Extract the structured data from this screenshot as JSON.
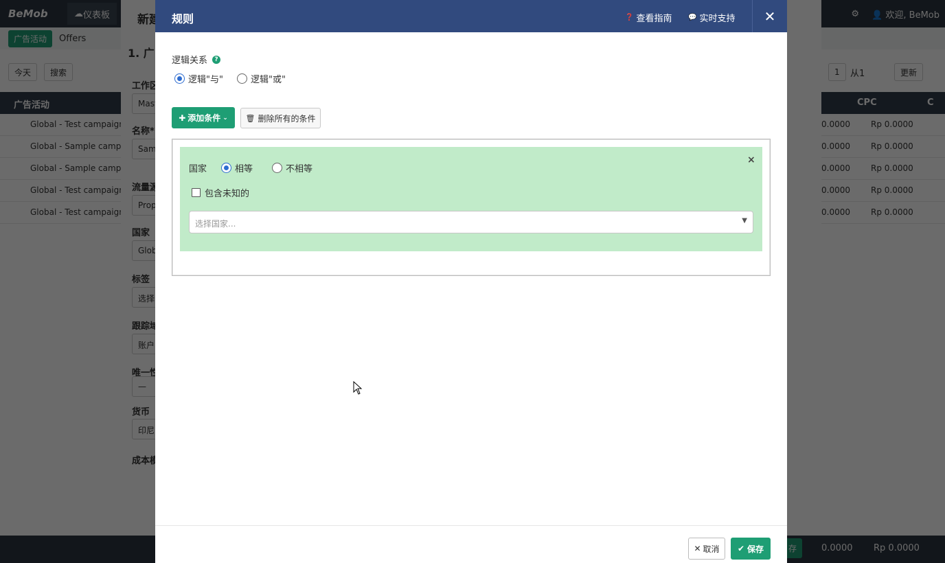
{
  "app": {
    "logo": "BeMob",
    "dashboard_tab": "仪表板",
    "welcome": "欢迎, BeMob",
    "campaigns_tab": "广告活动",
    "offers_tab": "Offers",
    "period": "今天",
    "search_placeholder": "搜索",
    "page_number": "1",
    "page_of": "从1",
    "refresh": "更新",
    "col_campaign": "广告活动",
    "col_cpc": "CPC",
    "col_extra": "C",
    "rows": [
      {
        "name": "Global - Test campaign",
        "a": "0.0000",
        "b": "Rp 0.0000"
      },
      {
        "name": "Global - Sample campai",
        "a": "0.0000",
        "b": "Rp 0.0000"
      },
      {
        "name": "Global - Sample campai",
        "a": "0.0000",
        "b": "Rp 0.0000"
      },
      {
        "name": "Global - Test campaign",
        "a": "0.0000",
        "b": "Rp 0.0000"
      },
      {
        "name": "Global - Test campaign",
        "a": "0.0000",
        "b": "Rp 0.0000"
      }
    ],
    "totals": {
      "a": "0.0000",
      "b": "Rp 0.0000"
    }
  },
  "side_panel": {
    "title": "新建",
    "step": "1. 广",
    "fields": [
      {
        "label": "工作区",
        "value": "Mast"
      },
      {
        "label": "名称*",
        "value": "Samp"
      },
      {
        "label": "流量源",
        "value": "Prop"
      },
      {
        "label": "国家",
        "value": "Glob"
      },
      {
        "label": "标签",
        "value": "选择"
      },
      {
        "label": "跟踪域",
        "value": "账户"
      },
      {
        "label": "唯一性",
        "value": "—"
      },
      {
        "label": "货币",
        "value": "印尼"
      },
      {
        "label": "成本模",
        "value": ""
      }
    ],
    "save_partial": "存"
  },
  "modal": {
    "title": "规则",
    "guide_link": "查看指南",
    "support_link": "实时支持",
    "logic_label": "逻辑关系",
    "logic_and": "逻辑\"与\"",
    "logic_or": "逻辑\"或\"",
    "logic_selected": "and",
    "add_condition": "添加条件",
    "delete_all": "删除所有的条件",
    "condition": {
      "label": "国家",
      "equal": "相等",
      "not_equal": "不相等",
      "selected": "equal",
      "include_unknown": "包含未知的",
      "country_placeholder": "选择国家..."
    },
    "cancel": "取消",
    "save": "保存"
  },
  "colors": {
    "header": "#314a7e",
    "accent": "#1e9e74",
    "condition_bg": "#c1ebc9",
    "radio_active": "#2d6cd0"
  },
  "icons": {
    "question": "question-circle-icon",
    "chat": "comments-icon",
    "close": "close-icon",
    "plus": "plus-icon",
    "trash": "trash-icon",
    "check": "check-icon"
  }
}
